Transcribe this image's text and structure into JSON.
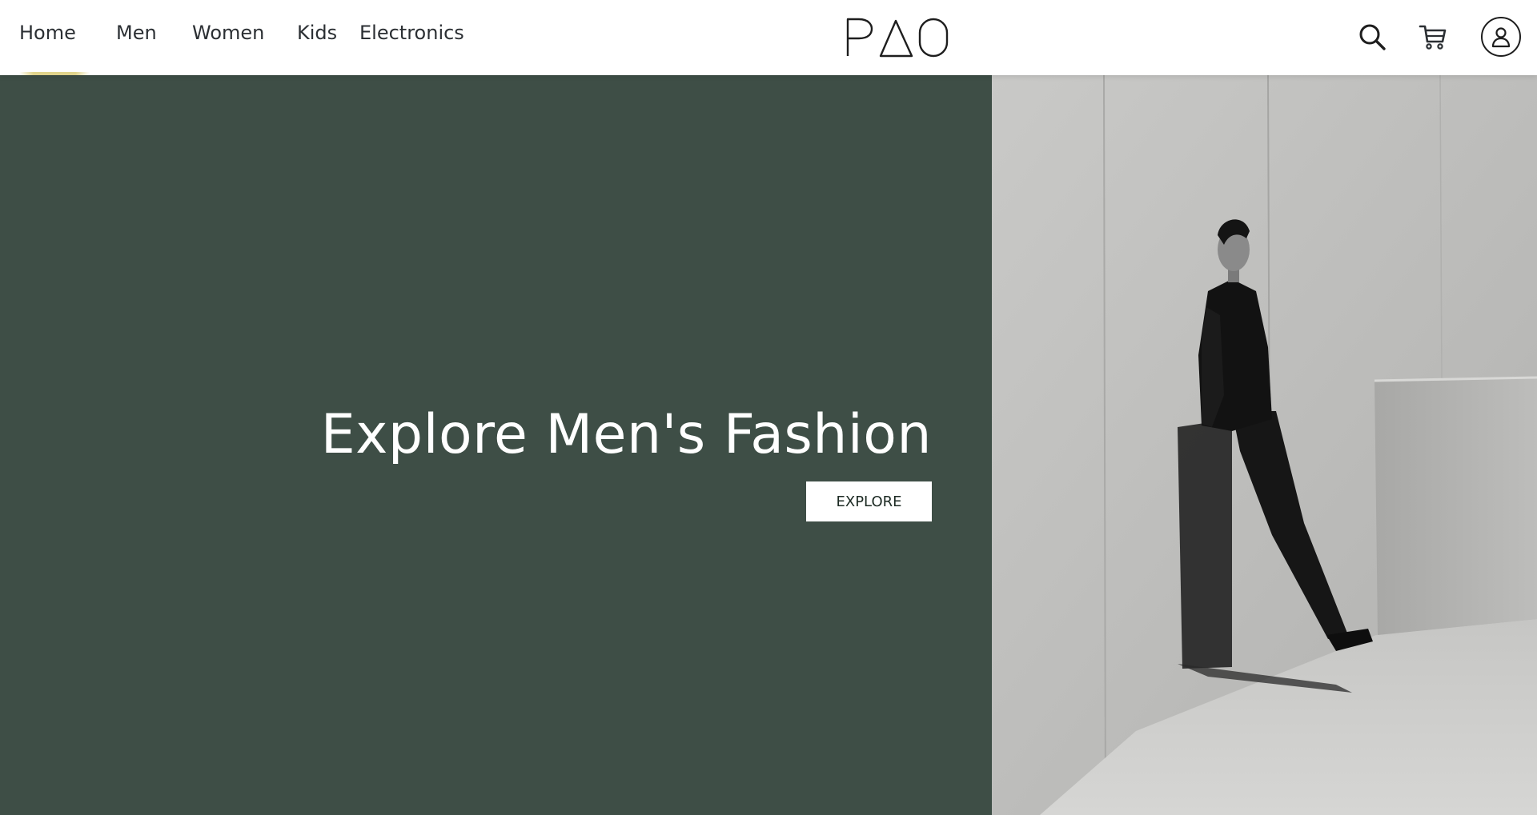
{
  "nav": {
    "items": [
      {
        "label": "Home"
      },
      {
        "label": "Men"
      },
      {
        "label": "Women"
      },
      {
        "label": "Kids"
      },
      {
        "label": "Electronics"
      }
    ]
  },
  "brand": {
    "logo_text": "PAO"
  },
  "header_actions": {
    "search_icon": "search-icon",
    "cart_icon": "cart-icon",
    "account_icon": "user-icon"
  },
  "hero": {
    "title": "Explore Men's Fashion",
    "button_label": "EXPLORE",
    "image_alt": "Man in black suit leaning against a concrete wall"
  },
  "colors": {
    "hero_background": "#3e4e46",
    "text_dark": "#2b2f33",
    "accent_underline": "#dccd78"
  }
}
